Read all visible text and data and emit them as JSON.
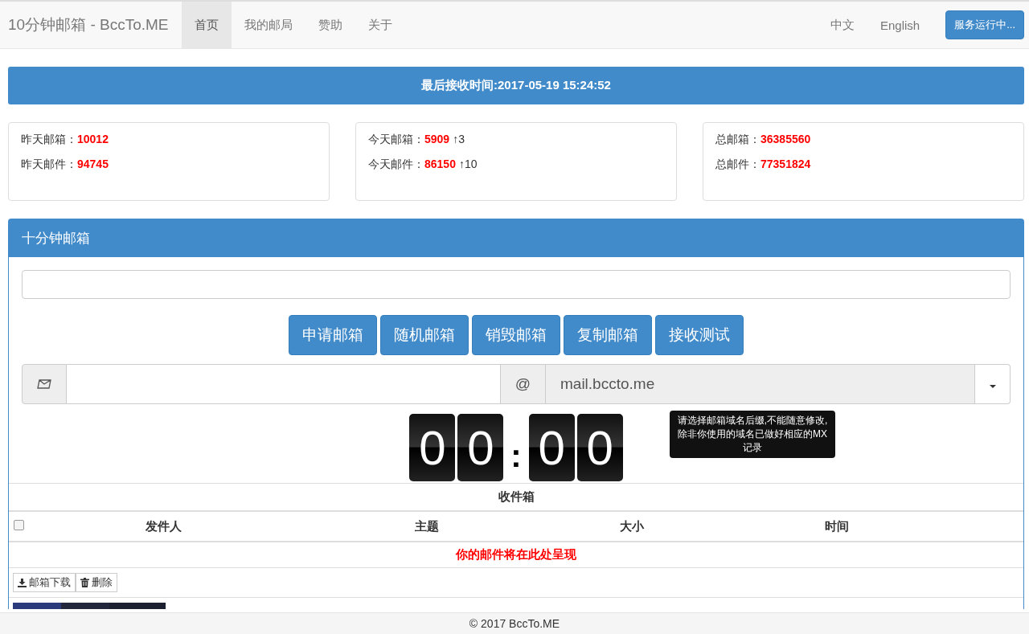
{
  "navbar": {
    "brand": "10分钟邮箱 - BccTo.ME",
    "nav_items": [
      {
        "label": "首页",
        "selected": true
      },
      {
        "label": "我的邮局",
        "selected": false
      },
      {
        "label": "赞助",
        "selected": false
      },
      {
        "label": "关于",
        "selected": false
      }
    ],
    "languages": [
      "中文",
      "English"
    ],
    "status_button": "服务运行中..."
  },
  "banner": "最后接收时间:2017-05-19 15:24:52",
  "stats": [
    {
      "rows": [
        {
          "label": "昨天邮箱：",
          "value": "10012"
        },
        {
          "label": "昨天邮件：",
          "value": "94745"
        }
      ]
    },
    {
      "rows": [
        {
          "label": "今天邮箱：",
          "value": "5909",
          "delta": "↑3"
        },
        {
          "label": "今天邮件：",
          "value": "86150",
          "delta": "↑10"
        }
      ]
    },
    {
      "rows": [
        {
          "label": "总邮箱：",
          "value": "36385560"
        },
        {
          "label": "总邮件：",
          "value": "77351824"
        }
      ]
    }
  ],
  "panel": {
    "title": "十分钟邮箱",
    "buttons": [
      "申请邮箱",
      "随机邮箱",
      "销毁邮箱",
      "复制邮箱",
      "接收测试"
    ],
    "at_sign": "@",
    "domain": "mail.bccto.me",
    "tooltip": "请选择邮箱域名后缀,不能随意修改,除非你使用的域名已做好相应的MX记录",
    "timer": {
      "minutes": [
        "0",
        "0"
      ],
      "separator": ":",
      "seconds": [
        "0",
        "0"
      ]
    },
    "inbox": {
      "title": "收件箱",
      "select_all": false,
      "columns": [
        "发件人",
        "主题",
        "大小",
        "时间"
      ],
      "empty_message": "你的邮件将在此处呈现"
    },
    "actions": [
      {
        "kind": "download",
        "label": "邮箱下载"
      },
      {
        "kind": "delete",
        "label": "删除"
      }
    ]
  },
  "footer": "© 2017 BccTo.ME"
}
